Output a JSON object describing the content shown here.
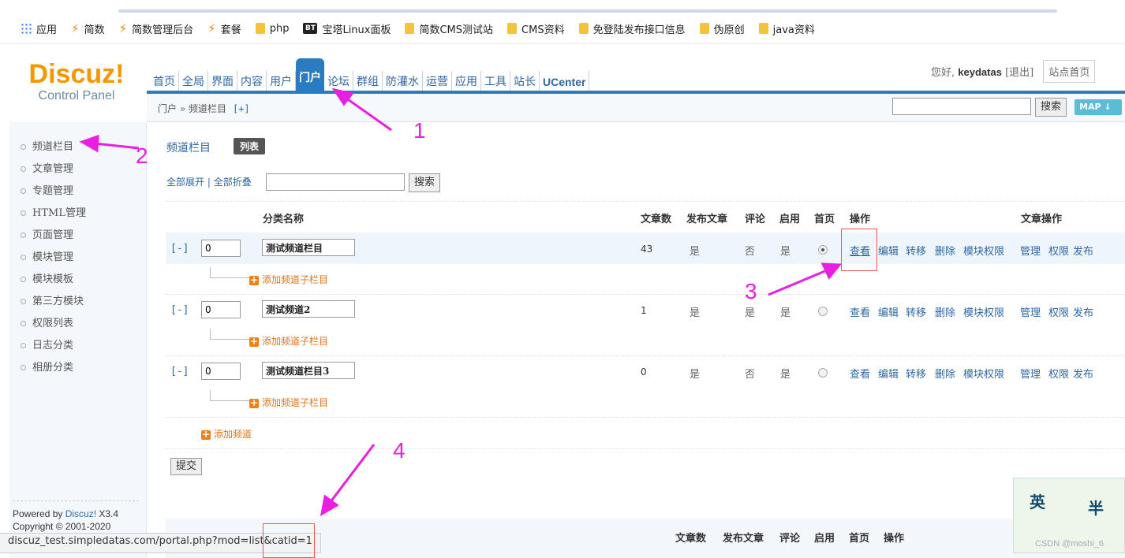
{
  "bookmarks": [
    "应用",
    "简数",
    "简数管理后台",
    "套餐",
    "php",
    "宝塔Linux面板",
    "简数CMS测试站",
    "CMS资料",
    "免登陆发布接口信息",
    "伪原创",
    "java资料"
  ],
  "bookmark_icons": [
    "apps-grid",
    "leaf",
    "leaf",
    "leaf",
    "folder",
    "bt-logo",
    "folder",
    "folder",
    "folder",
    "folder",
    "folder"
  ],
  "logo": {
    "main": "Discuz!",
    "sub": "Control Panel"
  },
  "topnav": [
    "首页",
    "全局",
    "界面",
    "内容",
    "用户",
    "门户",
    "论坛",
    "群组",
    "防灌水",
    "运营",
    "应用",
    "工具",
    "站长",
    "UCenter"
  ],
  "topnav_active": "门户",
  "user": {
    "greeting": "您好,",
    "name": "keydatas",
    "logout": "[退出]",
    "site_home": "站点首页"
  },
  "breadcrumb": {
    "path": "门户 » 频道栏目",
    "add": "[+]"
  },
  "top_search": {
    "button": "搜索",
    "map": "MAP ↓"
  },
  "sidebar": [
    "频道栏目",
    "文章管理",
    "专题管理",
    "HTML管理",
    "页面管理",
    "模块管理",
    "模块模板",
    "第三方模块",
    "权限列表",
    "日志分类",
    "相册分类"
  ],
  "powered": {
    "line1_prefix": "Powered by ",
    "line1_link": "Discuz!",
    "line1_suffix": " X3.4",
    "line2": "Copyright © 2001-2020"
  },
  "page": {
    "title": "频道栏目",
    "tab": "列表",
    "expand_all": "全部展开",
    "collapse_all": "全部折叠",
    "sep": "|",
    "search_button": "搜索"
  },
  "table": {
    "headers": {
      "name": "分类名称",
      "count": "文章数",
      "publish": "发布文章",
      "comment": "评论",
      "enabled": "启用",
      "home": "首页",
      "ops": "操作",
      "article_ops": "文章操作"
    },
    "rows": [
      {
        "toggle": "[-]",
        "order": "0",
        "name": "测试频道栏目",
        "count": "43",
        "publish": "是",
        "comment": "否",
        "enabled": "是",
        "home_checked": true,
        "view": "查看",
        "edit": "编辑",
        "move": "转移",
        "delete": "删除",
        "perm": "模块权限",
        "manage": "管理",
        "aperm": "权限",
        "post": "发布",
        "add_sub": "添加频道子栏目"
      },
      {
        "toggle": "[-]",
        "order": "0",
        "name": "测试频道2",
        "count": "1",
        "publish": "是",
        "comment": "是",
        "enabled": "是",
        "home_checked": false,
        "view": "查看",
        "edit": "编辑",
        "move": "转移",
        "delete": "删除",
        "perm": "模块权限",
        "manage": "管理",
        "aperm": "权限",
        "post": "发布",
        "add_sub": "添加频道子栏目"
      },
      {
        "toggle": "[-]",
        "order": "0",
        "name": "测试频道栏目3",
        "count": "0",
        "publish": "是",
        "comment": "否",
        "enabled": "是",
        "home_checked": false,
        "view": "查看",
        "edit": "编辑",
        "move": "转移",
        "delete": "删除",
        "perm": "模块权限",
        "manage": "管理",
        "aperm": "权限",
        "post": "发布",
        "add_sub": "添加频道子栏目"
      }
    ],
    "add_channel": "添加频道",
    "submit": "提交"
  },
  "footer_headers": {
    "count": "文章数",
    "publish": "发布文章",
    "comment": "评论",
    "enabled": "启用",
    "home": "首页",
    "ops": "操作"
  },
  "status_url": "discuz_test.simpledatas.com/portal.php?mod=list&catid=1",
  "annotations": [
    "1",
    "2",
    "3",
    "4"
  ],
  "deco_text": [
    "英",
    "半"
  ],
  "watermark": "CSDN @moshi_6",
  "colors": {
    "accent": "#2b7bc0",
    "logo": "#f39800",
    "annotation": "#e81ee0",
    "add": "#e2721b"
  }
}
